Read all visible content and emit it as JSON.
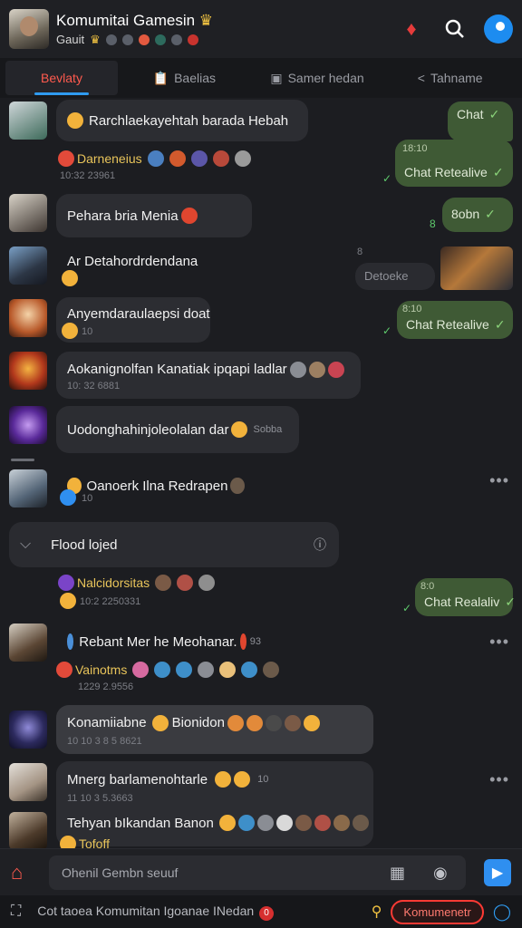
{
  "header": {
    "title": "Komumitai Gamesin",
    "subtitle": "Gauit",
    "colors": {
      "accent": "#ff5a4e",
      "brand_blue": "#1d8cf0"
    }
  },
  "tabs": [
    {
      "label": "Bevlaty",
      "icon": "none-icon",
      "active": true
    },
    {
      "label": "Baelias",
      "icon": "clipboard-icon",
      "active": false
    },
    {
      "label": "Samer hedan",
      "icon": "image-icon",
      "active": false
    },
    {
      "label": "Tahname",
      "icon": "share-icon",
      "active": false
    }
  ],
  "messages": [
    {
      "text": "Rarchlaekayehtah barada Hebah",
      "sender": "Darneneius",
      "time": "10:32 23961"
    },
    {
      "text": "Pehara bria Menia"
    },
    {
      "text": "Ar Detahordrdendana"
    },
    {
      "text": "Anyemdaraulaepsi doat",
      "time": "10"
    },
    {
      "text": "Aokanignolfan Kanatiak ipqapi ladlar",
      "time": "10: 32 6881"
    },
    {
      "text": "Uodonghahinjoleolalan dar",
      "extra": "Sobba"
    },
    {
      "text": "Oanoerk Ilna Redrapen",
      "time": "10"
    },
    {
      "text": "Flood lojed"
    },
    {
      "text": "Nalcidorsitas",
      "time": "10:2 2250331"
    },
    {
      "text": "Rebant Mer he Meohanar.",
      "extra": "93",
      "sender": "Vainotms",
      "time": "1229 2.9556"
    },
    {
      "text": "Konamiiabne",
      "extra": "Bionidon",
      "time": "10 10 3 8 5 8621"
    },
    {
      "text": "Mnerg barlamenohtarle",
      "extra": "10",
      "time": "11 10 3 5.3663"
    },
    {
      "text": "Tehyan bIkandan Banon",
      "sender": "Tofoff"
    }
  ],
  "outgoing": [
    {
      "text": "Chat",
      "status": "sent"
    },
    {
      "text": "Chat Retealive",
      "time": "18:10"
    },
    {
      "text": "8obn",
      "time": "8"
    },
    {
      "text": "Detoeke",
      "time": "8"
    },
    {
      "text": "Chat Retealive",
      "time": "8:10"
    },
    {
      "text": "Chat Realaliv",
      "time": "8:0"
    }
  ],
  "composer": {
    "placeholder": "Ohenil Gembn seuuf"
  },
  "bottombar": {
    "text": "Cot taoea Komumitan Igoanae INedan",
    "badge": "0",
    "button": "Komumenetr"
  }
}
